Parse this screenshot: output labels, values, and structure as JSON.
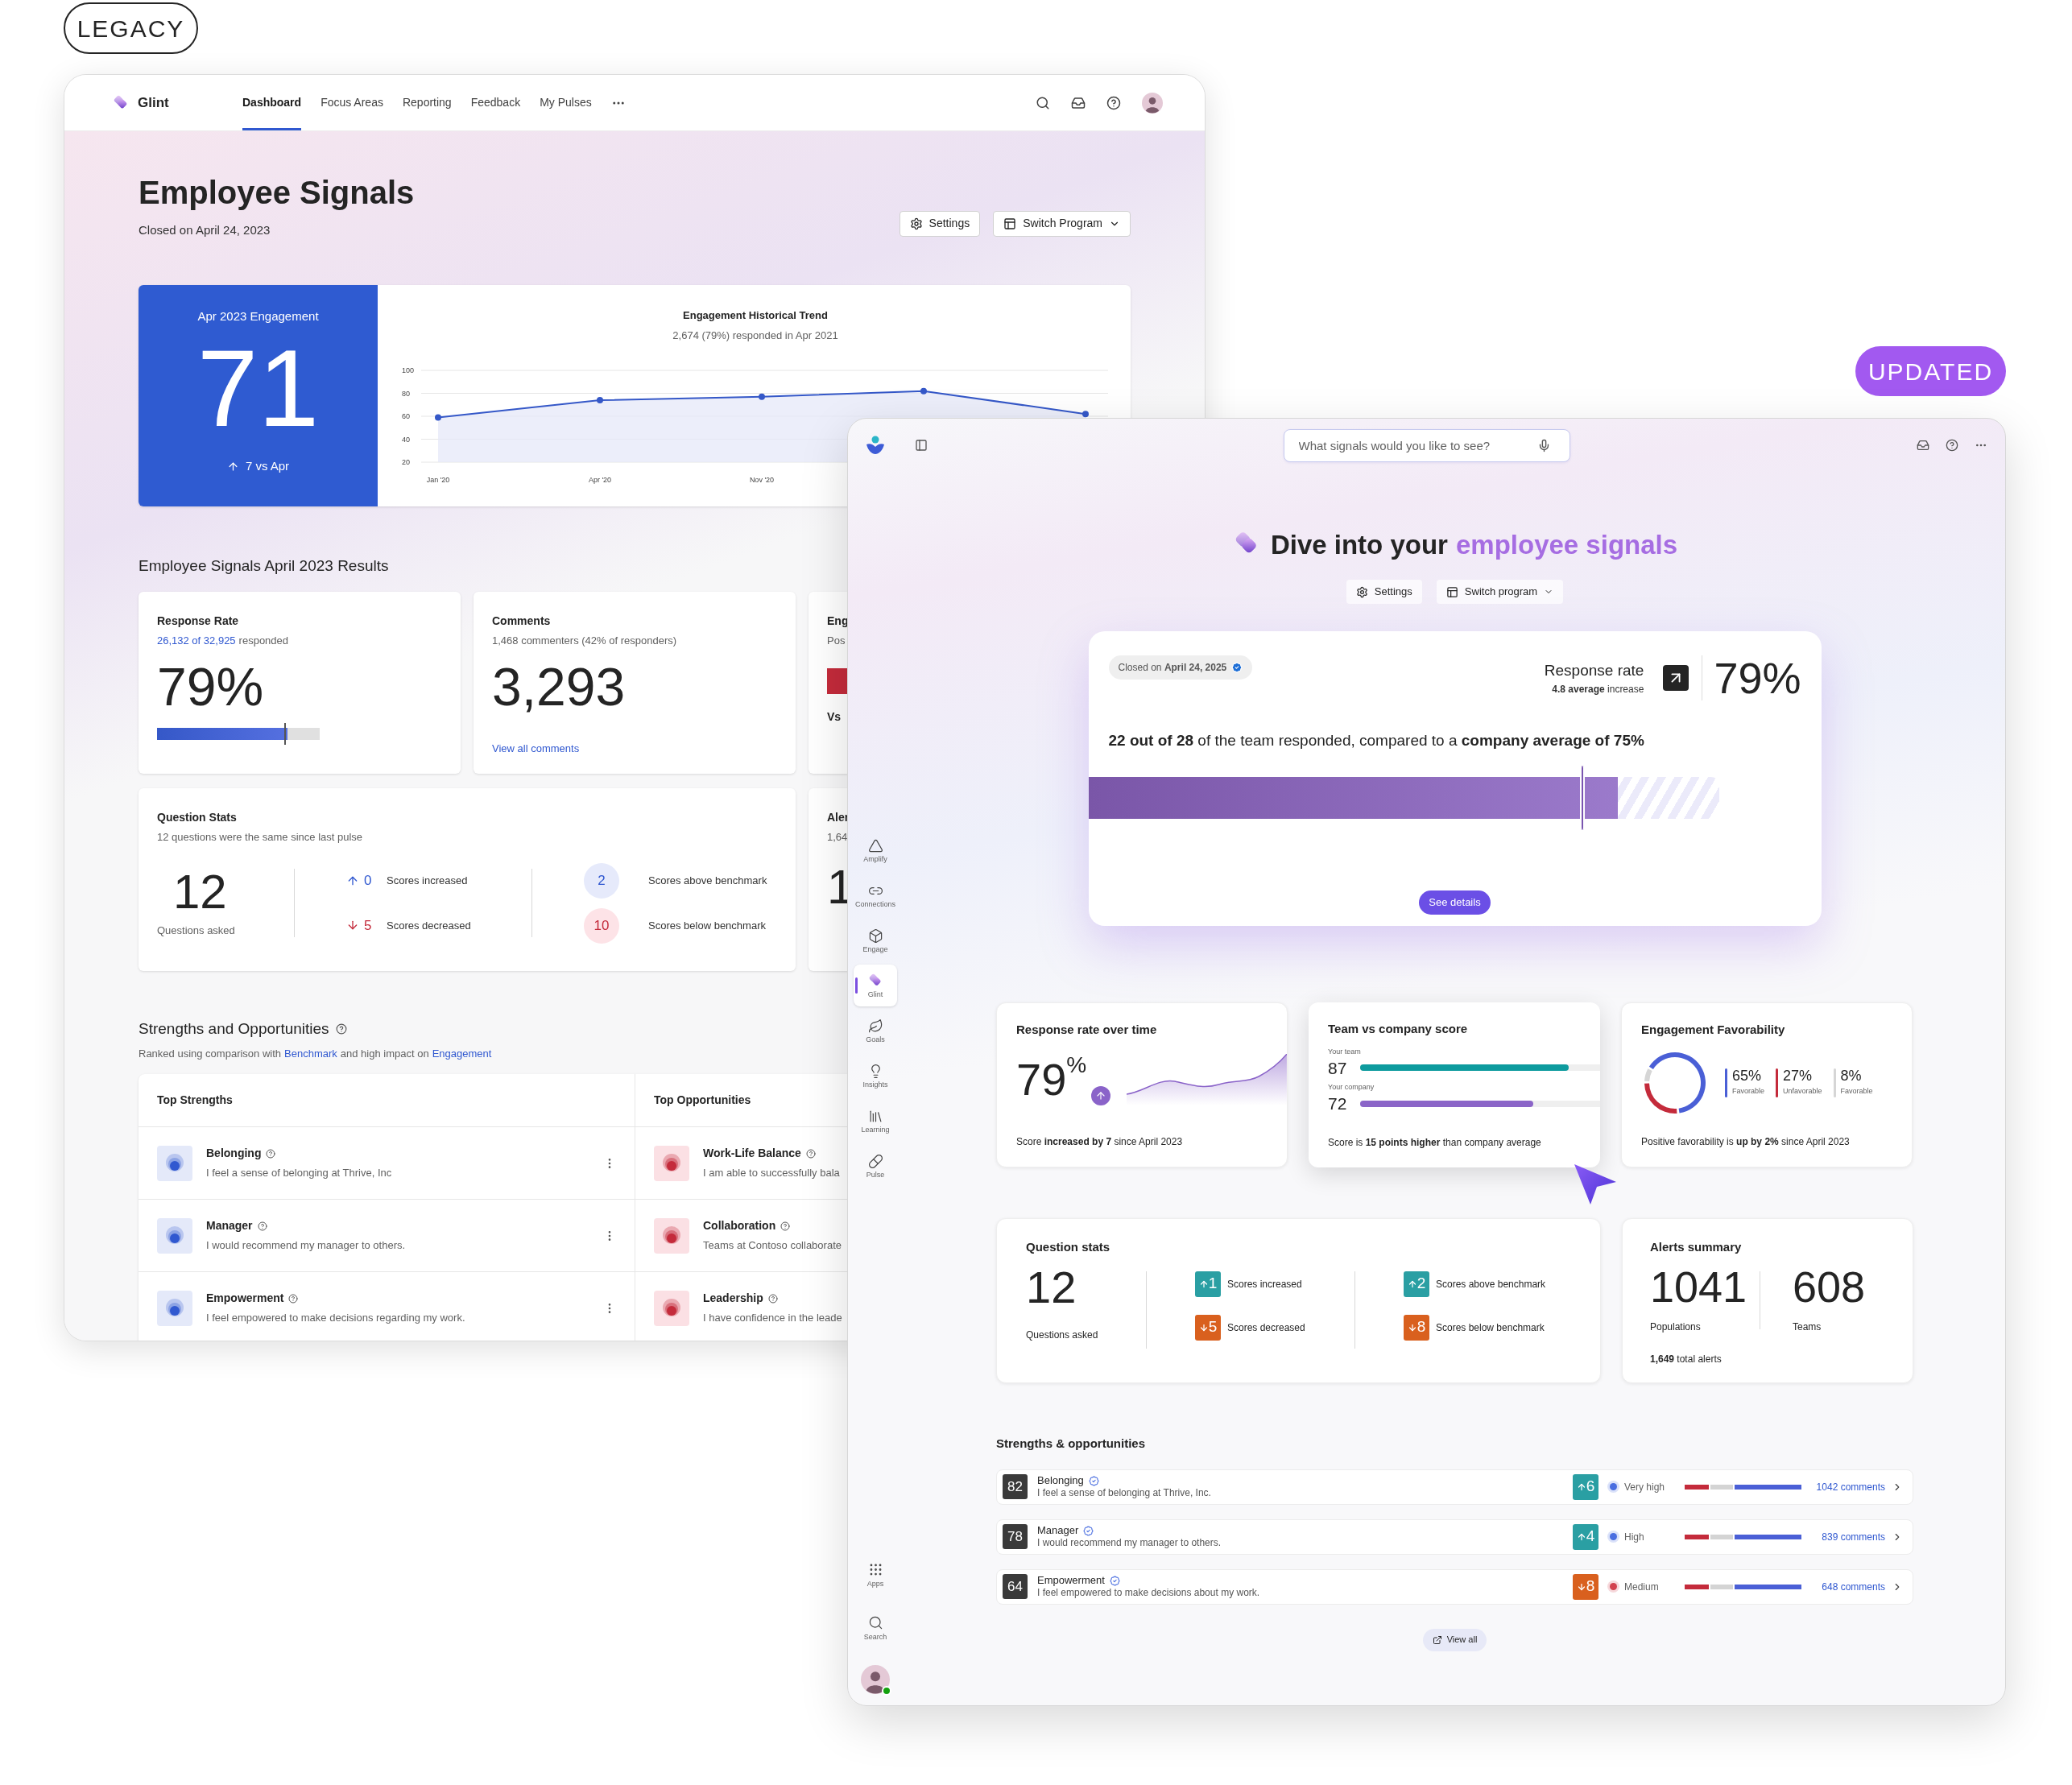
{
  "legacy_label": "LEGACY",
  "updated_label": "UPDATED",
  "legacy": {
    "app_name": "Glint",
    "nav": [
      {
        "label": "Dashboard",
        "selected": true
      },
      {
        "label": "Focus Areas",
        "selected": false
      },
      {
        "label": "Reporting",
        "selected": false
      },
      {
        "label": "Feedback",
        "selected": false
      },
      {
        "label": "My Pulses",
        "selected": false
      }
    ],
    "title": "Employee Signals",
    "closed": "Closed on April 24, 2023",
    "buttons": [
      {
        "kind": "settings",
        "label": "Settings"
      },
      {
        "kind": "switch",
        "label": "Switch Program"
      }
    ],
    "engagement": {
      "label": "Apr 2023 Engagement",
      "score": "71",
      "change": "7 vs Apr"
    },
    "trend": {
      "title": "Engagement Historical Trend",
      "subtitle": "2,674 (79%) responded in Apr 2021",
      "chart_data": {
        "type": "line",
        "categories": [
          "Jan '20",
          "Apr '20",
          "Nov '20",
          null,
          null
        ],
        "ylim": [
          20,
          100
        ],
        "yticks": [
          20,
          40,
          60,
          80,
          100
        ],
        "grid": true,
        "marker": true,
        "values": [
          59,
          74,
          77,
          82,
          62
        ]
      }
    },
    "results_heading": "Employee Signals April 2023 Results",
    "response_rate": {
      "title": "Response Rate",
      "link": "26,132 of 32,925",
      "suffix": "responded",
      "value": "79%",
      "bar": {
        "level": 0.8
      },
      "marker": {
        "level": 0.78
      }
    },
    "comments": {
      "title": "Comments",
      "subtitle": "1,468 commenters (42% of responders)",
      "value": "3,293",
      "link": "View all comments"
    },
    "favorability_partial": {
      "title": "Eng",
      "subtitle": "Pos",
      "footer": "Vs"
    },
    "alerts_partial": {
      "title": "Aler",
      "subtitle": "1,64",
      "value": "1"
    },
    "question_stats": {
      "title": "Question Stats",
      "subtitle": "12 questions were the same since last pulse",
      "count": "12",
      "count_label": "Questions asked",
      "changes": [
        {
          "kind": "up",
          "value": "0",
          "label": "Scores increased"
        },
        {
          "kind": "down",
          "value": "5",
          "label": "Scores decreased"
        }
      ],
      "benchmarks": [
        {
          "kind": "above",
          "value": "2",
          "label": "Scores above benchmark"
        },
        {
          "kind": "below",
          "value": "10",
          "label": "Scores below benchmark"
        }
      ]
    },
    "strengths": {
      "title": "Strengths and Opportunities",
      "subtitle": [
        {
          "text": "Ranked using comparison with",
          "link": false
        },
        {
          "text": "Benchmark",
          "link": true
        },
        {
          "text": "and high impact on",
          "link": false
        },
        {
          "text": "Engagement",
          "link": true
        }
      ],
      "columns": [
        {
          "kind": "strength",
          "title": "Top Strengths",
          "rows": [
            {
              "name": "Belonging",
              "description": "I feel a sense of belonging at Thrive, Inc"
            },
            {
              "name": "Manager",
              "description": "I would recommend my manager to others."
            },
            {
              "name": "Empowerment",
              "description": "I feel empowered to make decisions regarding my work."
            }
          ]
        },
        {
          "kind": "opportunity",
          "title": "Top Opportunities",
          "rows": [
            {
              "name": "Work-Life Balance",
              "description": "I am able to successfully bala"
            },
            {
              "name": "Collaboration",
              "description": "Teams at Contoso collaborate"
            },
            {
              "name": "Leadership",
              "description": "I have confidence in the leade"
            }
          ]
        }
      ]
    }
  },
  "updated": {
    "search": {
      "placeholder": "What signals would you like to see?"
    },
    "rail": [
      {
        "kind": "amplify",
        "label": "Amplify",
        "selected": false
      },
      {
        "kind": "connections",
        "label": "Connections",
        "selected": false
      },
      {
        "kind": "engage",
        "label": "Engage",
        "selected": false
      },
      {
        "kind": "glint",
        "label": "Glint",
        "selected": true
      },
      {
        "kind": "goals",
        "label": "Goals",
        "selected": false
      },
      {
        "kind": "insights",
        "label": "Insights",
        "selected": false
      },
      {
        "kind": "learning",
        "label": "Learning",
        "selected": false
      },
      {
        "kind": "pulse",
        "label": "Pulse",
        "selected": false
      }
    ],
    "rail_bottom": [
      {
        "kind": "apps",
        "label": "Apps"
      },
      {
        "kind": "search",
        "label": "Search"
      }
    ],
    "avatar": {
      "online": true
    },
    "heading": {
      "lead": "Dive into your",
      "accent": "employee signals"
    },
    "buttons": [
      {
        "kind": "settings",
        "label": "Settings"
      },
      {
        "kind": "switch",
        "label": "Switch program"
      }
    ],
    "hero": {
      "closed": "Closed on **April 24, 2025**",
      "metric_title": "Response rate",
      "metric_sub": "**4.8 average** increase",
      "value": "79%",
      "sentence": "**22 out of 28** of the team responded, compared to a **company average of 75%**",
      "bar": {
        "level": 0.84
      },
      "company_marker": {
        "level": 0.78
      },
      "button": "See details"
    },
    "response_over_time": {
      "title": "Response rate over time",
      "value": "79",
      "unit": "%",
      "note": "Score **increased by 7** since April 2023"
    },
    "team_vs_company": {
      "title": "Team vs company score",
      "rows": [
        {
          "label": "Your team",
          "value": "87",
          "level": 0.87,
          "color": "#0e9b9e"
        },
        {
          "label": "Your company",
          "value": "72",
          "level": 0.72,
          "color": "#8b65c8"
        }
      ],
      "note": "Score is **15 points higher** than company average"
    },
    "favorability": {
      "title": "Engagement Favorability",
      "chart_data": {
        "type": "donut",
        "categories": [
          "Favorable",
          "Unfavorable",
          "Favorable"
        ],
        "values": [
          65,
          27,
          8
        ],
        "value_labels": [
          "65%",
          "27%",
          "8%"
        ]
      },
      "note": "Positive favorability is **up by 2%** since April 2023"
    },
    "question_stats": {
      "title": "Question stats",
      "count": "12",
      "count_label": "Questions asked",
      "changes": [
        {
          "kind": "up",
          "value": "1",
          "label": "Scores increased"
        },
        {
          "kind": "down",
          "value": "5",
          "label": "Scores decreased"
        }
      ],
      "benchmarks": [
        {
          "kind": "up",
          "value": "2",
          "label": "Scores above benchmark"
        },
        {
          "kind": "down",
          "value": "8",
          "label": "Scores below benchmark"
        }
      ]
    },
    "alerts": {
      "title": "Alerts summary",
      "stats": [
        {
          "value": "1041",
          "label": "Populations"
        },
        {
          "value": "608",
          "label": "Teams"
        }
      ],
      "total": "**1,649** total alerts"
    },
    "strengths": {
      "title": "Strengths & opportunities",
      "rows": [
        {
          "score": "82",
          "name": "Belonging",
          "description": "I feel a sense of belonging at Thrive, Inc.",
          "change": {
            "kind": "up",
            "value": "6"
          },
          "impact": {
            "label": "Very high",
            "color": "#4a6ee0"
          },
          "comments": "1042 comments"
        },
        {
          "score": "78",
          "name": "Manager",
          "description": "I would recommend my manager to others.",
          "change": {
            "kind": "up",
            "value": "4"
          },
          "impact": {
            "label": "High",
            "color": "#4a6ee0"
          },
          "comments": "839 comments"
        },
        {
          "score": "64",
          "name": "Empowerment",
          "description": "I feel empowered to make decisions about my work.",
          "change": {
            "kind": "down",
            "value": "8"
          },
          "impact": {
            "label": "Medium",
            "color": "#d2424f"
          },
          "comments": "648 comments"
        }
      ],
      "view_all": "View all"
    }
  }
}
